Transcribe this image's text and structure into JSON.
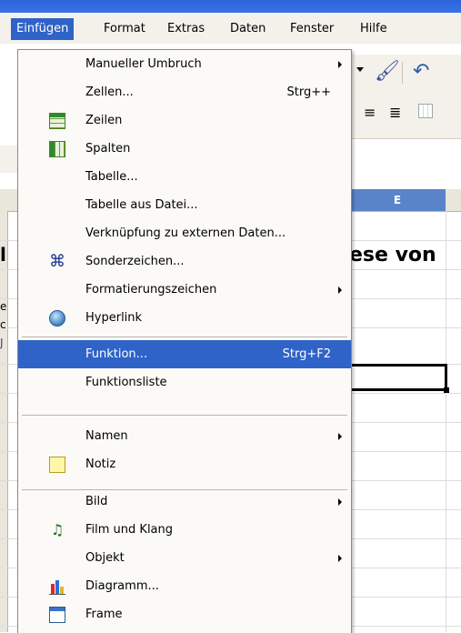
{
  "menubar": {
    "items": [
      "Einfügen",
      "Format",
      "Extras",
      "Daten",
      "Fenster",
      "Hilfe"
    ]
  },
  "sheet": {
    "column_header": "E",
    "cell_text": "ese von",
    "left_fragments": [
      "l",
      "e",
      "c",
      "J"
    ]
  },
  "menu": {
    "items": [
      {
        "label": "Manueller Umbruch",
        "submenu": true
      },
      {
        "label": "Zellen...",
        "shortcut": "Strg++"
      },
      {
        "label": "Zeilen",
        "icon": "rows-icon"
      },
      {
        "label": "Spalten",
        "icon": "columns-icon"
      },
      {
        "label": "Tabelle..."
      },
      {
        "label": "Tabelle aus Datei..."
      },
      {
        "label": "Verknüpfung zu externen Daten..."
      },
      {
        "label": "Sonderzeichen...",
        "icon": "special-character-icon"
      },
      {
        "label": "Formatierungszeichen",
        "submenu": true
      },
      {
        "label": "Hyperlink",
        "icon": "hyperlink-icon"
      },
      {
        "label": "Funktion...",
        "shortcut": "Strg+F2",
        "highlighted": true
      },
      {
        "label": "Funktionsliste"
      },
      {
        "label": "Namen",
        "submenu": true
      },
      {
        "label": "Notiz",
        "icon": "note-icon"
      },
      {
        "label": "Bild",
        "submenu": true
      },
      {
        "label": "Film und Klang",
        "icon": "film-sound-icon"
      },
      {
        "label": "Objekt",
        "submenu": true
      },
      {
        "label": "Diagramm...",
        "icon": "chart-icon"
      },
      {
        "label": "Frame",
        "icon": "frame-icon"
      }
    ]
  },
  "colors": {
    "highlight": "#2f63c8",
    "menu_bg": "#fbfaf7",
    "column_selected": "#5a84c9"
  }
}
